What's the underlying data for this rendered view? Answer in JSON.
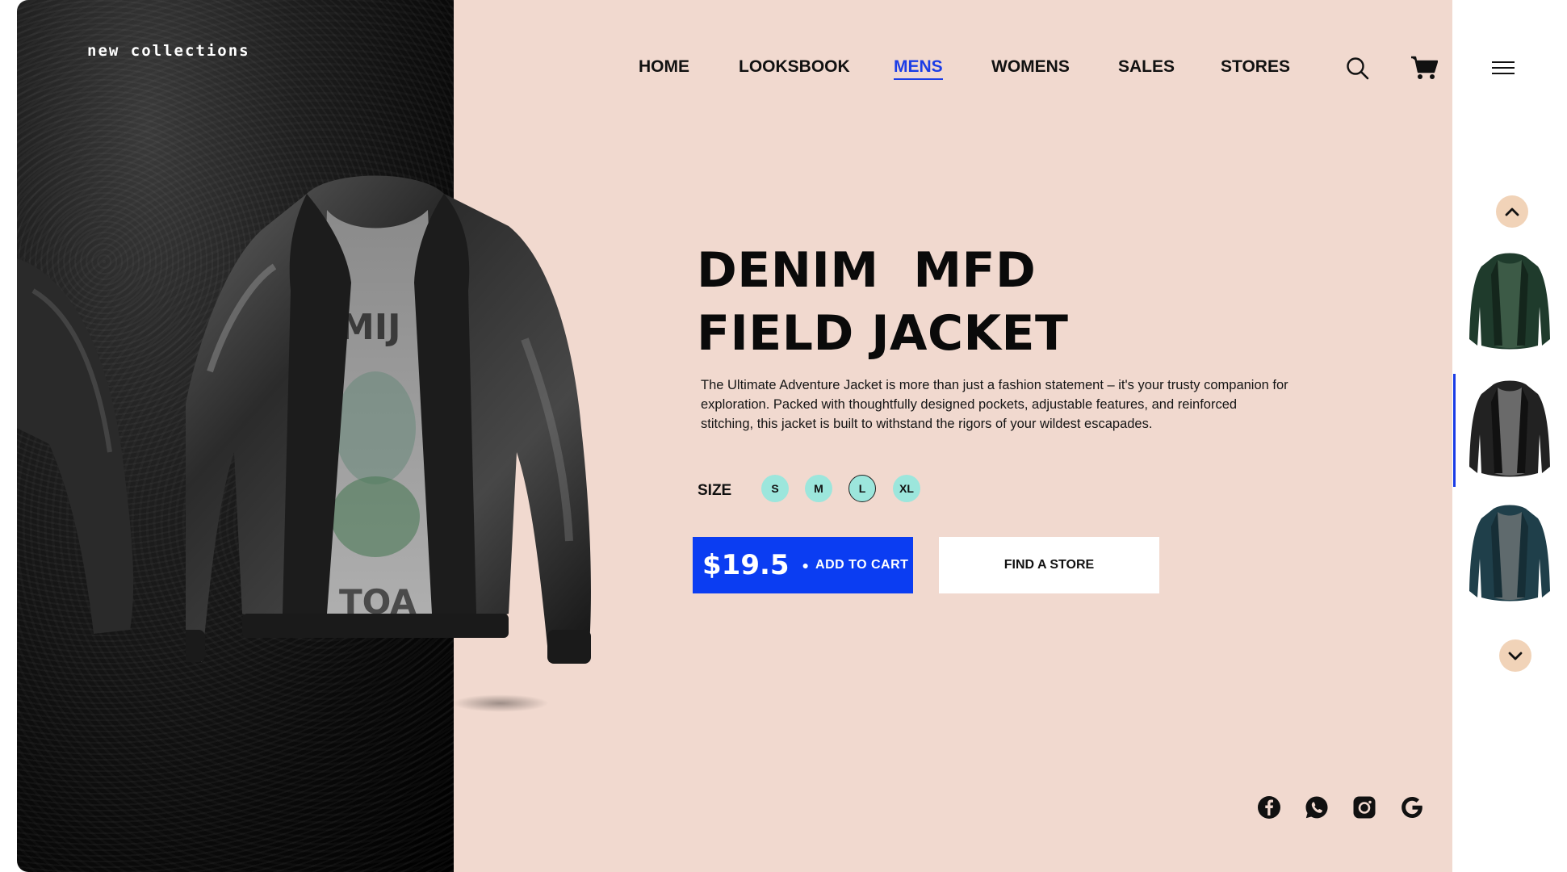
{
  "brand": {
    "name": "new collections"
  },
  "nav": {
    "items": [
      {
        "label": "HOME",
        "active": false
      },
      {
        "label": "LOOKSBOOK",
        "active": false
      },
      {
        "label": "MENS",
        "active": true
      },
      {
        "label": "WOMENS",
        "active": false
      },
      {
        "label": "SALES",
        "active": false
      },
      {
        "label": "STORES",
        "active": false
      }
    ],
    "icons": [
      "search-icon",
      "cart-icon",
      "menu-icon"
    ]
  },
  "product": {
    "title_line1": "DENIM  MFD",
    "title_line2": "FIELD JACKET",
    "description": "The Ultimate Adventure Jacket is more than just a fashion statement – it's your trusty companion for exploration. Packed with thoughtfully designed pockets, adjustable features, and reinforced stitching, this jacket is built to withstand the rigors of your wildest escapades.",
    "size_label": "SIZE",
    "sizes": [
      "S",
      "M",
      "L",
      "XL"
    ],
    "selected_size": "L",
    "price": "$19.5",
    "add_to_cart_label": "ADD TO CART",
    "find_store_label": "FIND A STORE"
  },
  "social": [
    "facebook-icon",
    "whatsapp-icon",
    "instagram-icon",
    "google-icon"
  ],
  "thumbnails": [
    {
      "color": "green",
      "active": false
    },
    {
      "color": "black",
      "active": true
    },
    {
      "color": "teal",
      "active": false
    }
  ],
  "colors": {
    "accent": "#1b3de6",
    "cart_button": "#0b3df2",
    "page_bg": "#f1d9cf",
    "size_chip": "#9ce6dc",
    "arrow_bg": "#f1d3b8"
  }
}
